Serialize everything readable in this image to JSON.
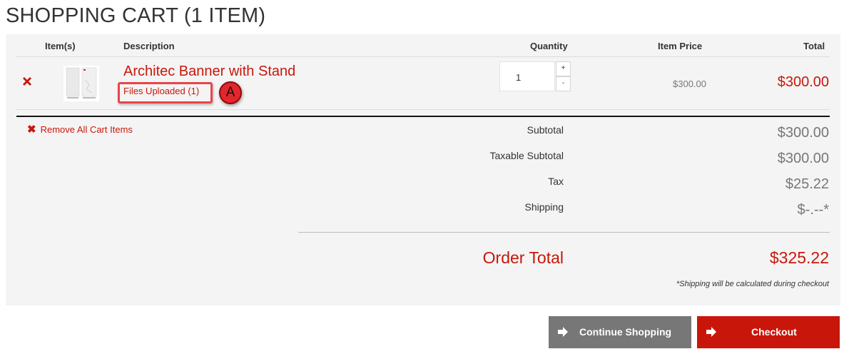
{
  "page": {
    "title": "SHOPPING CART (1 ITEM)"
  },
  "table": {
    "headers": {
      "items": "Item(s)",
      "description": "Description",
      "quantity": "Quantity",
      "item_price": "Item Price",
      "total": "Total"
    }
  },
  "cart_item": {
    "name": "Architec Banner with Stand",
    "files_link": "Files Uploaded (1)",
    "quantity": "1",
    "qty_plus": "+",
    "qty_minus": "-",
    "item_price": "$300.00",
    "total": "$300.00",
    "annotation_badge": "A"
  },
  "summary": {
    "remove_all": "Remove All Cart Items",
    "subtotal_label": "Subtotal",
    "subtotal": "$300.00",
    "taxable_label": "Taxable Subtotal",
    "taxable": "$300.00",
    "tax_label": "Tax",
    "tax": "$25.22",
    "shipping_label": "Shipping",
    "shipping": "$-.--*",
    "order_total_label": "Order Total",
    "order_total": "$325.22",
    "shipping_note": "*Shipping will be calculated during checkout"
  },
  "buttons": {
    "continue": "Continue Shopping",
    "checkout": "Checkout"
  },
  "colors": {
    "accent": "#c8170a",
    "panel": "#f4f4f4",
    "secondary_button": "#777777"
  },
  "icons": {
    "remove": "close-x-icon",
    "arrow": "arrow-right-icon"
  }
}
